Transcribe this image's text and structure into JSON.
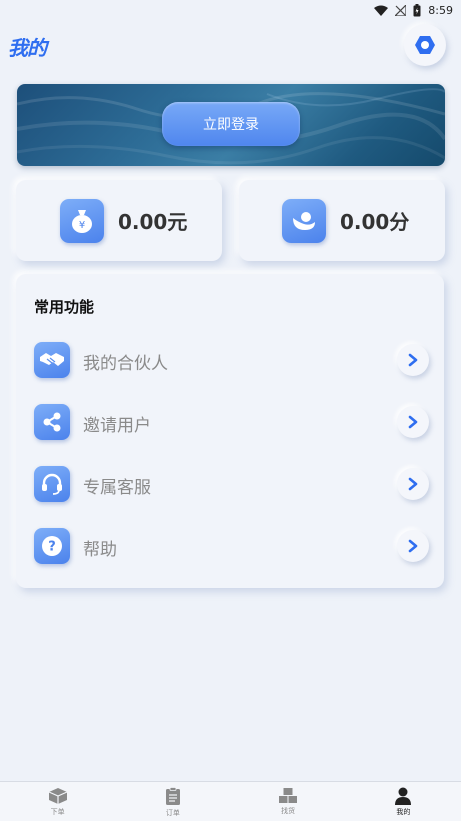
{
  "status_bar": {
    "time": "8:59"
  },
  "header": {
    "title": "我的"
  },
  "banner": {
    "login_label": "立即登录"
  },
  "balances": {
    "money": "0.00元",
    "points": "0.00分"
  },
  "functions": {
    "title": "常用功能",
    "items": [
      {
        "label": "我的合伙人",
        "icon": "handshake-icon"
      },
      {
        "label": "邀请用户",
        "icon": "share-icon"
      },
      {
        "label": "专属客服",
        "icon": "headset-icon"
      },
      {
        "label": "帮助",
        "icon": "question-icon"
      }
    ]
  },
  "nav": {
    "items": [
      {
        "label": "下单",
        "icon": "box-icon"
      },
      {
        "label": "订单",
        "icon": "clipboard-icon"
      },
      {
        "label": "找货",
        "icon": "goods-icon"
      },
      {
        "label": "我的",
        "icon": "person-icon"
      }
    ],
    "active_index": 3
  },
  "colors": {
    "accent": "#2f6ef0",
    "badge_top": "#7eaef8",
    "badge_bottom": "#4b82ec",
    "background": "#eef2f9"
  }
}
